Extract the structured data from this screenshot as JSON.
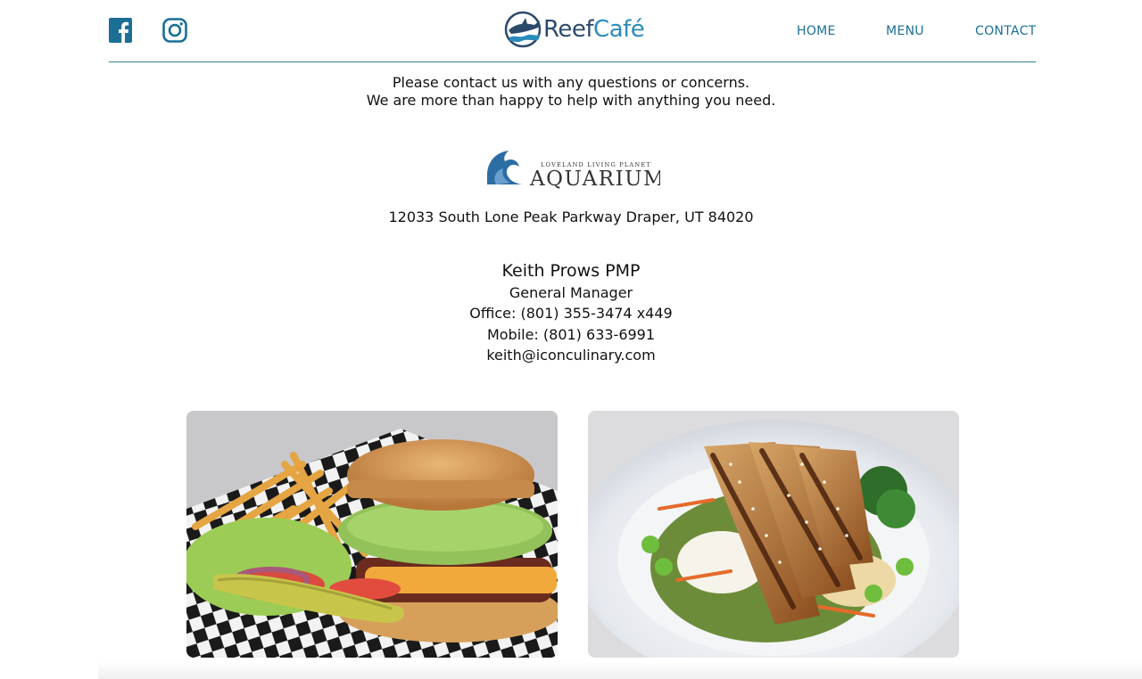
{
  "header": {
    "social": {
      "facebook_icon": "facebook-icon",
      "instagram_icon": "instagram-icon"
    },
    "logo": {
      "reef": "Reef",
      "cafe": "Café"
    },
    "nav": {
      "home": "HOME",
      "menu": "MENU",
      "contact": "CONTACT"
    }
  },
  "main": {
    "intro_line1": "Please contact us with any questions or concerns.",
    "intro_line2": "We are more than happy to help with anything you need.",
    "aquarium_logo": {
      "small": "LOVELAND LIVING PLANET",
      "large": "AQUARIUM"
    },
    "address": "12033 South Lone Peak Parkway Draper, UT 84020",
    "contact": {
      "name": "Keith Prows PMP",
      "title": "General Manager",
      "office": "Office: (801) 355-3474 x449",
      "mobile": "Mobile: (801) 633-6991",
      "email": "keith@iconculinary.com"
    },
    "photos": [
      "burger-photo",
      "chicken-bowl-photo"
    ]
  },
  "colors": {
    "accent": "#1b6f95",
    "divider": "#2f7f96",
    "logo_dark": "#2b4a6b",
    "logo_light": "#2a8bbb"
  }
}
